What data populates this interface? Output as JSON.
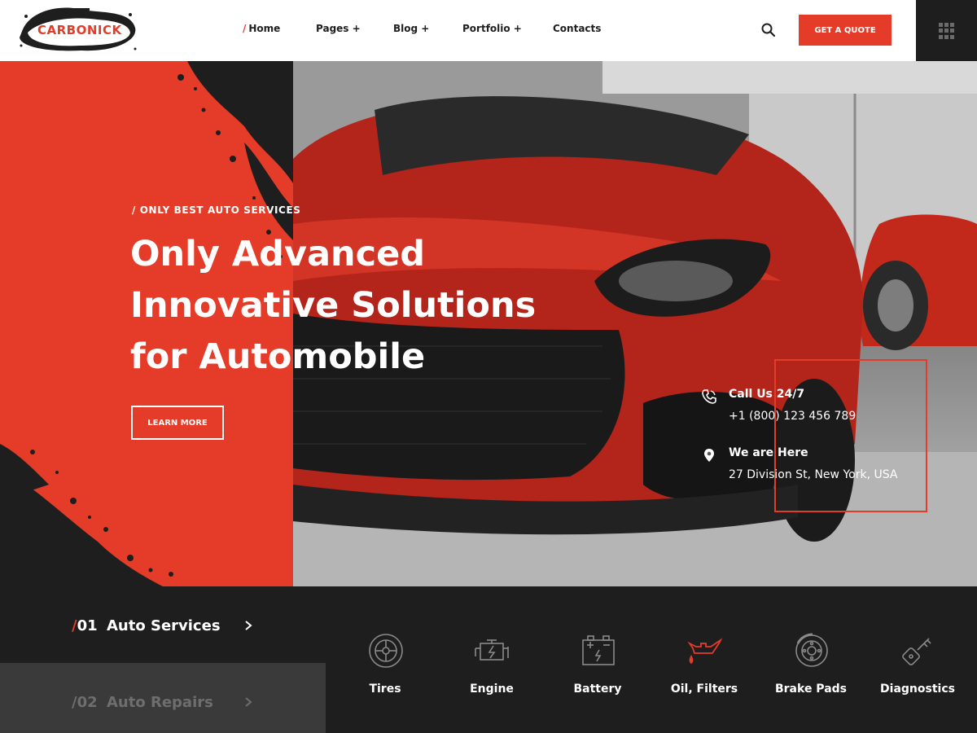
{
  "header": {
    "logo_text": "CARBONICK",
    "nav": [
      {
        "label": "Home",
        "prefix": "/",
        "active": true
      },
      {
        "label": "Pages +"
      },
      {
        "label": "Blog +"
      },
      {
        "label": "Portfolio +"
      },
      {
        "label": "Contacts"
      }
    ],
    "search_icon": "search-icon",
    "quote_label": "GET A QUOTE",
    "menu_icon": "grid-menu-icon"
  },
  "hero": {
    "tagline": "/ ONLY BEST AUTO SERVICES",
    "title_lines": [
      "Only Advanced",
      "Innovative Solutions",
      "for Automobile"
    ],
    "cta_label": "LEARN MORE",
    "contacts": [
      {
        "icon": "phone-icon",
        "title": "Call Us 24/7",
        "value": "+1 (800) 123 456 789"
      },
      {
        "icon": "location-pin-icon",
        "title": "We are Here",
        "value": "27 Division St, New York, USA"
      }
    ]
  },
  "services": {
    "categories": [
      {
        "number": "01",
        "prefix": "/",
        "label": "Auto Services",
        "active": true
      },
      {
        "number": "02",
        "prefix": "/",
        "label": "Auto Repairs",
        "active": false
      }
    ],
    "items": [
      {
        "label": "Tires",
        "icon": "tire-icon",
        "highlight": false
      },
      {
        "label": "Engine",
        "icon": "engine-icon",
        "highlight": false
      },
      {
        "label": "Battery",
        "icon": "battery-icon",
        "highlight": false
      },
      {
        "label": "Oil, Filters",
        "icon": "oil-can-icon",
        "highlight": true
      },
      {
        "label": "Brake Pads",
        "icon": "brake-disc-icon",
        "highlight": false
      },
      {
        "label": "Diagnostics",
        "icon": "diagnostic-key-icon",
        "highlight": false
      }
    ]
  },
  "colors": {
    "accent": "#e43c28",
    "dark": "#1e1e1e",
    "white": "#ffffff",
    "muted": "#6e6e6e"
  }
}
